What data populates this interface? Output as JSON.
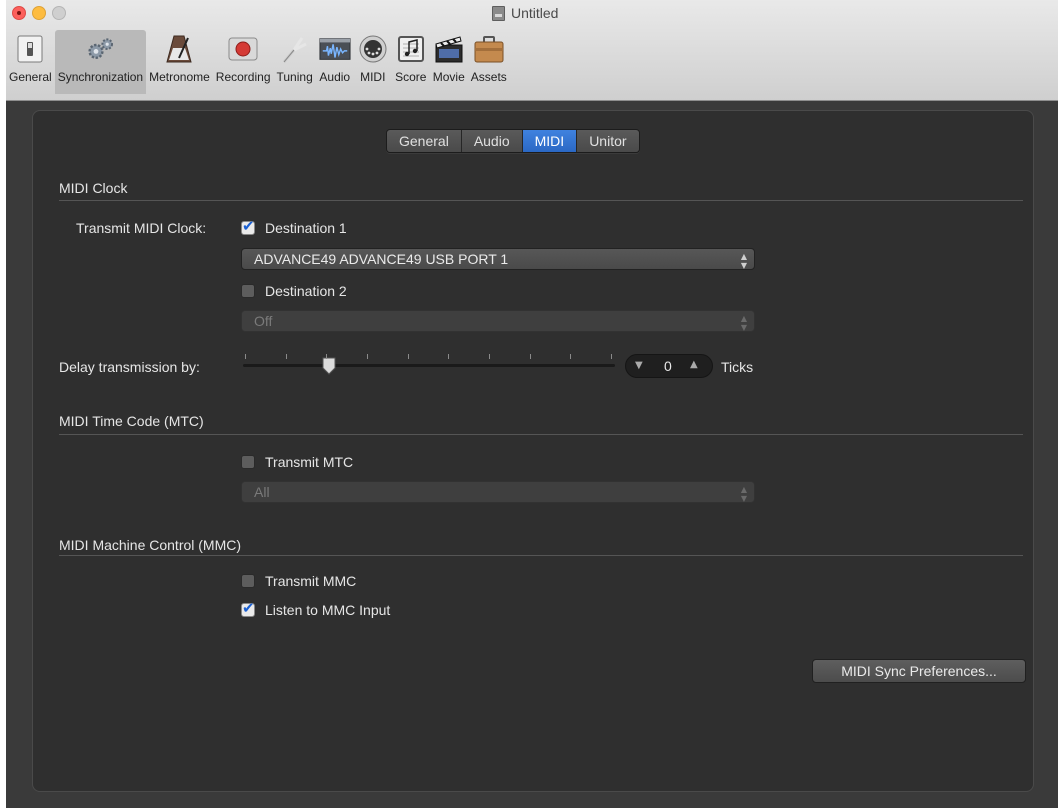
{
  "window": {
    "title": "Untitled"
  },
  "toolbar": {
    "items": [
      {
        "label": "General",
        "icon": "switch-icon"
      },
      {
        "label": "Synchronization",
        "icon": "gears-icon",
        "selected": true
      },
      {
        "label": "Metronome",
        "icon": "metronome-icon"
      },
      {
        "label": "Recording",
        "icon": "record-icon"
      },
      {
        "label": "Tuning",
        "icon": "tuning-fork-icon"
      },
      {
        "label": "Audio",
        "icon": "waveform-icon"
      },
      {
        "label": "MIDI",
        "icon": "midi-connector-icon"
      },
      {
        "label": "Score",
        "icon": "score-icon"
      },
      {
        "label": "Movie",
        "icon": "clapperboard-icon"
      },
      {
        "label": "Assets",
        "icon": "briefcase-icon"
      }
    ]
  },
  "tabs": [
    {
      "label": "General"
    },
    {
      "label": "Audio"
    },
    {
      "label": "MIDI",
      "active": true
    },
    {
      "label": "Unitor"
    }
  ],
  "midi_clock": {
    "title": "MIDI Clock",
    "transmit_label": "Transmit MIDI Clock:",
    "dest1_label": "Destination 1",
    "dest1_checked": true,
    "dest1_value": "ADVANCE49 ADVANCE49 USB PORT 1",
    "dest2_label": "Destination 2",
    "dest2_checked": false,
    "dest2_value": "Off",
    "delay_label": "Delay transmission by:",
    "delay_value": "0",
    "delay_unit": "Ticks",
    "delay_slider_fraction": 0.23
  },
  "mtc": {
    "title": "MIDI Time Code (MTC)",
    "transmit_label": "Transmit MTC",
    "transmit_checked": false,
    "value": "All"
  },
  "mmc": {
    "title": "MIDI Machine Control (MMC)",
    "transmit_label": "Transmit MMC",
    "transmit_checked": false,
    "listen_label": "Listen to MMC Input",
    "listen_checked": true
  },
  "buttons": {
    "midi_sync_prefs": "MIDI Sync Preferences..."
  },
  "colors": {
    "accent": "#2f6fd4",
    "panel_bg": "#2f2f2f",
    "window_bg": "#3a3a3a"
  }
}
